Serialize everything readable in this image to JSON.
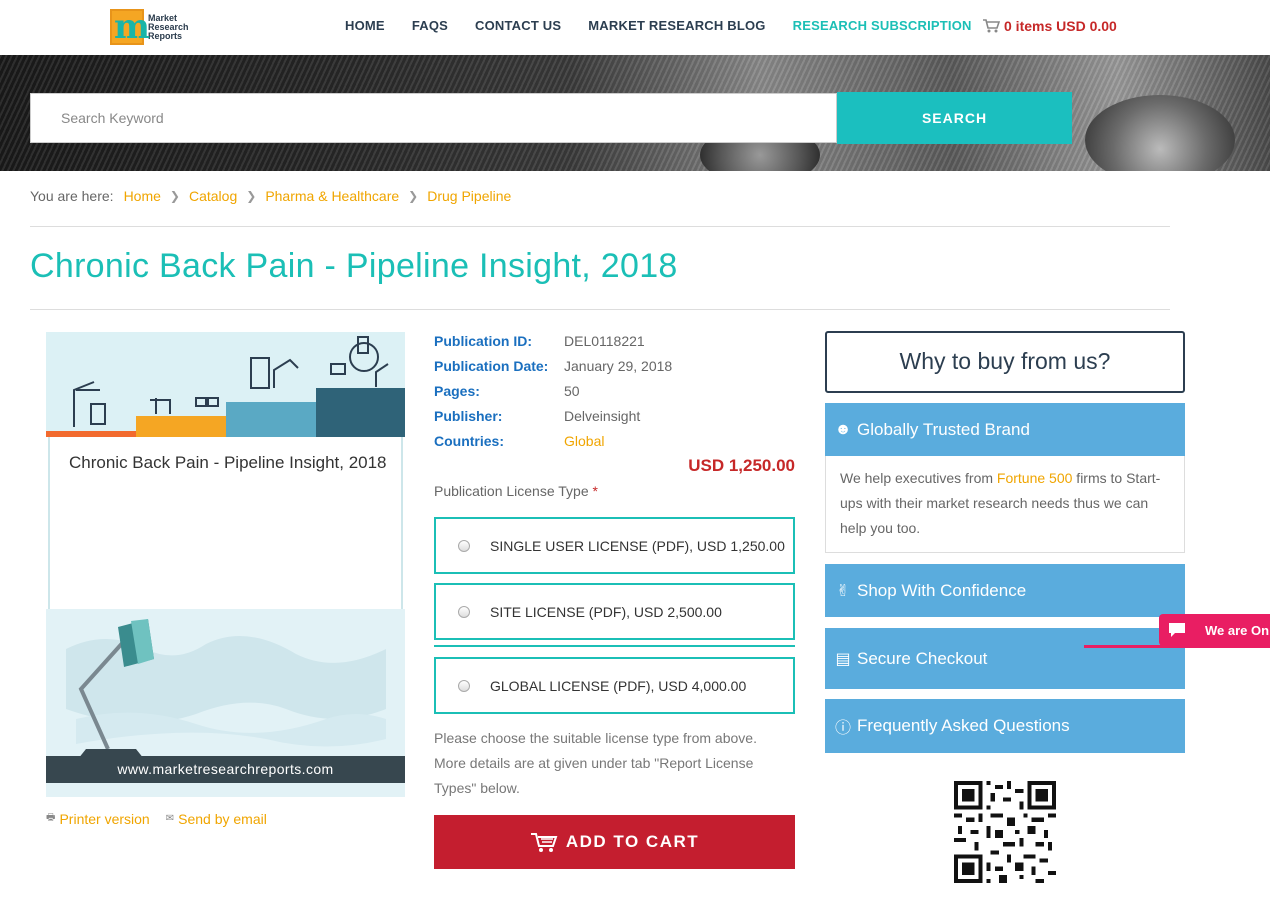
{
  "header": {
    "logo_lines": [
      "Market",
      "Research",
      "Reports"
    ],
    "nav": [
      "HOME",
      "FAQS",
      "CONTACT US",
      "MARKET RESEARCH BLOG",
      "RESEARCH SUBSCRIPTION"
    ],
    "cart_text": "0 items USD 0.00"
  },
  "search": {
    "placeholder": "Search Keyword",
    "button": "SEARCH"
  },
  "breadcrumb": {
    "label": "You are here:",
    "items": [
      "Home",
      "Catalog",
      "Pharma & Healthcare",
      "Drug Pipeline"
    ]
  },
  "page_title": "Chronic Back Pain - Pipeline Insight, 2018",
  "cover": {
    "title": "Chronic Back Pain - Pipeline Insight, 2018",
    "url": "www.marketresearchreports.com"
  },
  "tools": {
    "printer": "Printer version",
    "email": "Send by email"
  },
  "details": {
    "publication_id_label": "Publication ID:",
    "publication_id": "DEL0118221",
    "publication_date_label": "Publication Date:",
    "publication_date": "January 29, 2018",
    "pages_label": "Pages:",
    "pages": "50",
    "publisher_label": "Publisher:",
    "publisher": "Delveinsight",
    "countries_label": "Countries:",
    "countries": "Global"
  },
  "price": "USD 1,250.00",
  "license": {
    "label": "Publication License Type",
    "required_mark": "*",
    "options": [
      "SINGLE USER LICENSE (PDF), USD 1,250.00",
      "SITE LICENSE (PDF), USD 2,500.00",
      "GLOBAL LICENSE (PDF), USD 4,000.00"
    ],
    "note": "Please choose the suitable license type from above. More details are at given under tab \"Report License Types\" below."
  },
  "add_to_cart": "ADD TO CART",
  "sidebar": {
    "why_title": "Why to buy from us?",
    "trusted_title": "Globally Trusted Brand",
    "trusted_body_pre": "We help executives from ",
    "trusted_body_hl": "Fortune 500",
    "trusted_body_post": " firms to Start-ups with their market research needs thus we can help you too.",
    "shop": "Shop With Confidence",
    "checkout": "Secure Checkout",
    "faq": "Frequently Asked Questions"
  },
  "chat": {
    "text": "We are On"
  },
  "colors": {
    "accent_teal": "#1bbfb6",
    "link_orange": "#f0a500",
    "price_red": "#c62828",
    "cart_button": "#c41e2f",
    "panel_blue": "#5aacdd",
    "chat_pink": "#e91e63"
  }
}
